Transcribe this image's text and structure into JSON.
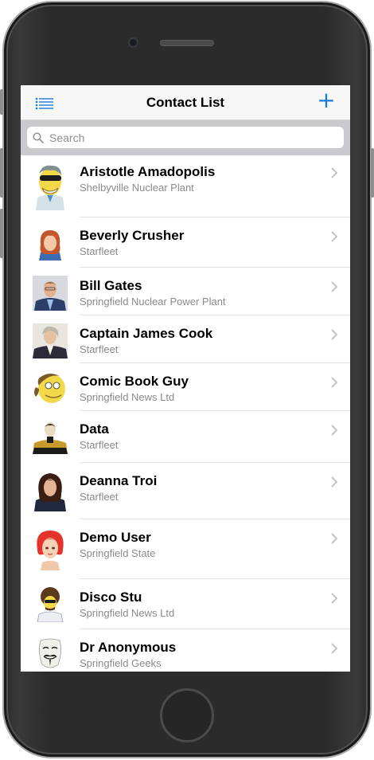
{
  "navbar": {
    "title": "Contact List",
    "add_label": "+",
    "list_icon": "list-icon",
    "accent_color": "#1e7bd8"
  },
  "search": {
    "placeholder": "Search",
    "icon": "search-icon"
  },
  "contacts": [
    {
      "name": "Aristotle Amadopolis",
      "company": "Shelbyville Nuclear Plant",
      "avatar": "cartoon-businessman-sunglasses"
    },
    {
      "name": "Beverly Crusher",
      "company": "Starfleet",
      "avatar": "red-haired-woman"
    },
    {
      "name": "Bill Gates",
      "company": "Springfield Nuclear Power Plant",
      "avatar": "man-in-suit-photo"
    },
    {
      "name": "Captain James Cook",
      "company": "Starfleet",
      "avatar": "historical-portrait"
    },
    {
      "name": "Comic Book Guy",
      "company": "Springfield News Ltd",
      "avatar": "cartoon-ponytail-man"
    },
    {
      "name": "Data",
      "company": "Starfleet",
      "avatar": "starfleet-uniform-android"
    },
    {
      "name": "Deanna Troi",
      "company": "Starfleet",
      "avatar": "dark-haired-woman"
    },
    {
      "name": "Demo User",
      "company": "Springfield State",
      "avatar": "3d-red-haired-woman"
    },
    {
      "name": "Disco Stu",
      "company": "Springfield News Ltd",
      "avatar": "cartoon-afro-man"
    },
    {
      "name": "Dr Anonymous",
      "company": "Springfield Geeks",
      "avatar": "guy-fawkes-mask"
    }
  ]
}
